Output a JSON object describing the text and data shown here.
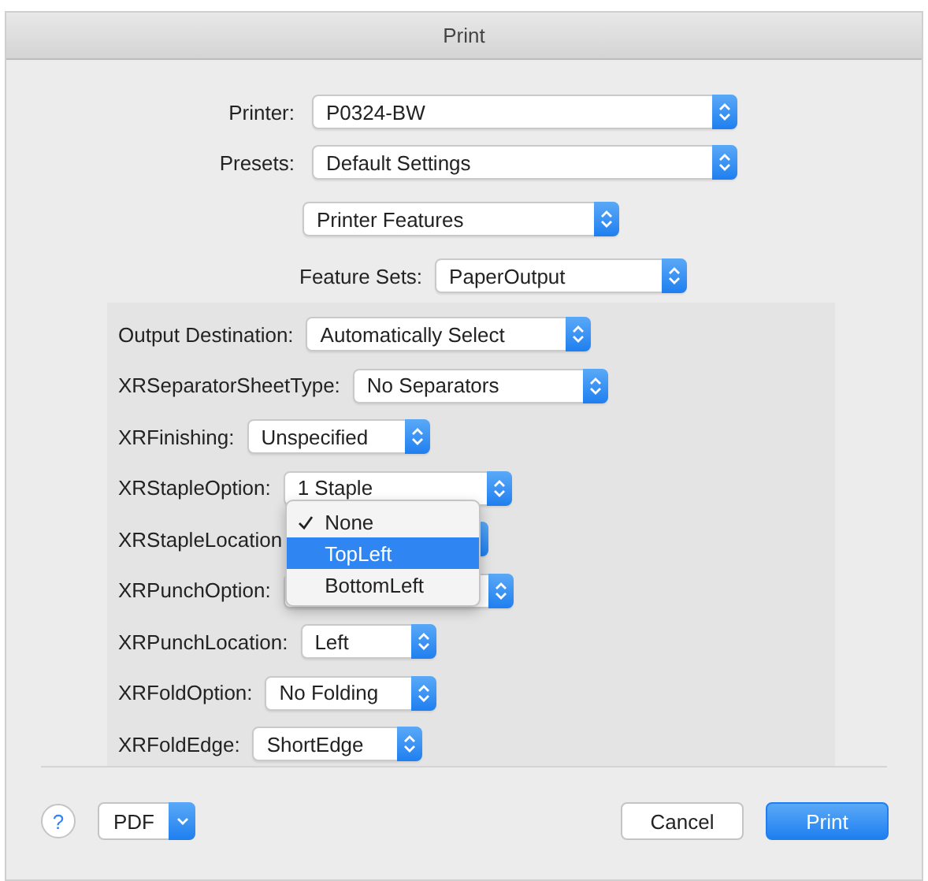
{
  "window": {
    "title": "Print"
  },
  "printer": {
    "label": "Printer:",
    "value": "P0324-BW"
  },
  "presets": {
    "label": "Presets:",
    "value": "Default Settings"
  },
  "section_popup": {
    "value": "Printer Features"
  },
  "feature_sets": {
    "label": "Feature Sets:",
    "value": "PaperOutput"
  },
  "features": [
    {
      "label": "Output Destination:",
      "value": "Automatically Select"
    },
    {
      "label": "XRSeparatorSheetType:",
      "value": "No Separators"
    },
    {
      "label": "XRFinishing:",
      "value": "Unspecified"
    },
    {
      "label": "XRStapleOption:",
      "value": "1 Staple"
    },
    {
      "label": "XRStapleLocation",
      "menu_open": true
    },
    {
      "label": "XRPunchOption:"
    },
    {
      "label": "XRPunchLocation:",
      "value": "Left"
    },
    {
      "label": "XRFoldOption:",
      "value": "No Folding"
    },
    {
      "label": "XRFoldEdge:",
      "value": "ShortEdge"
    }
  ],
  "menu": {
    "items": [
      {
        "label": "None",
        "checked": true,
        "selected": false
      },
      {
        "label": "TopLeft",
        "checked": false,
        "selected": true
      },
      {
        "label": "BottomLeft",
        "checked": false,
        "selected": false
      }
    ]
  },
  "help_button": {
    "label": "?"
  },
  "pdf_button": {
    "label": "PDF"
  },
  "buttons": [
    {
      "label": "Cancel",
      "kind": "secondary"
    },
    {
      "label": "Print",
      "kind": "primary"
    }
  ]
}
